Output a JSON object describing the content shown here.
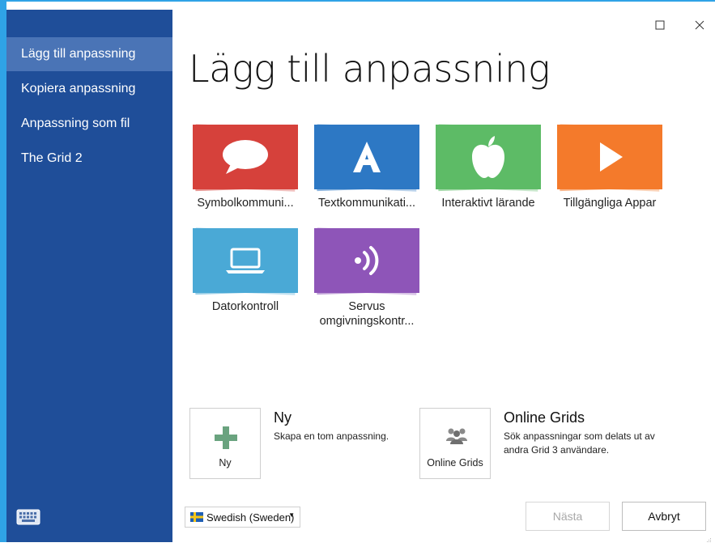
{
  "sidebar": {
    "items": [
      {
        "label": "Lägg till anpassning",
        "active": true
      },
      {
        "label": "Kopiera anpassning",
        "active": false
      },
      {
        "label": "Anpassning som fil",
        "active": false
      },
      {
        "label": "The Grid 2",
        "active": false
      }
    ]
  },
  "window": {
    "maximize_icon": "maximize-icon",
    "close_icon": "close-icon"
  },
  "main": {
    "title": "Lägg till anpassning",
    "tiles": [
      {
        "label": "Symbolkommuni...",
        "color": "#d6413b",
        "icon": "speech-bubble-icon"
      },
      {
        "label": "Textkommunikati...",
        "color": "#2d78c4",
        "icon": "letter-a-icon"
      },
      {
        "label": "Interaktivt lärande",
        "color": "#5dbb66",
        "icon": "apple-icon"
      },
      {
        "label": "Tillgängliga Appar",
        "color": "#f47a2b",
        "icon": "play-icon"
      },
      {
        "label": "Datorkontroll",
        "color": "#4aa9d6",
        "icon": "laptop-icon"
      },
      {
        "label_line1": "Servus",
        "label_line2": "omgivningskontr...",
        "color": "#8e55b8",
        "icon": "signal-icon"
      }
    ]
  },
  "actions": {
    "new": {
      "box_label": "Ny",
      "title": "Ny",
      "description": "Skapa en tom anpassning.",
      "icon": "plus-icon",
      "icon_color": "#6aa37f"
    },
    "online": {
      "box_label": "Online Grids",
      "title": "Online Grids",
      "description_line1": "Sök anpassningar som delats ut av",
      "description_line2": "andra Grid 3 användare.",
      "icon": "users-icon",
      "icon_color": "#8a8a8a"
    }
  },
  "footer": {
    "language": "Swedish (Sweden)",
    "next_label": "Nästa",
    "cancel_label": "Avbryt",
    "keyboard_icon": "keyboard-icon"
  },
  "colors": {
    "sidebar_bg": "#1f4e99",
    "sidebar_active": "#4a74b6",
    "window_border": "#2fa3e6"
  }
}
